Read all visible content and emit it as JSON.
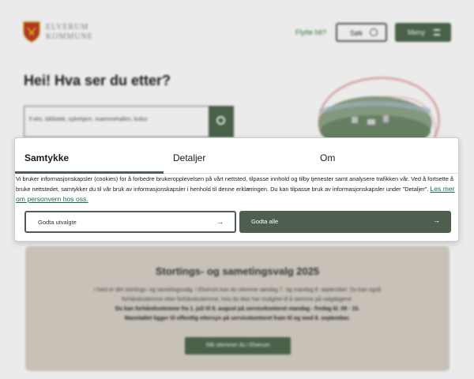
{
  "header": {
    "logo_text_line1": "ELVERUM",
    "logo_text_line2": "KOMMUNE",
    "nav_link_label": "Flytte hit?",
    "search_button_label": "Søk",
    "menu_button_label": "Meny",
    "icons": {
      "crest": "crest-icon",
      "search": "search-icon",
      "menu": "menu-icon"
    }
  },
  "hero": {
    "title": "Hei! Hva ser du etter?",
    "search_placeholder": "F.eks. bibliotek, sykehjem, svømmehallen, kultur"
  },
  "election": {
    "title": "Stortings- og sametingsvalg 2025",
    "body_line1": "I høst er det stortings- og sametingsvalg. I Elverum kan du stemme søndag 7. og mandag 8. september. Du kan også",
    "body_line2": "forhåndsstemme etter forhåndsstemme, hvis du ikke har mulighet til å stemme på valgdagene.",
    "body_bold1": "Du kan forhåndsstemme fra 1. juli til 8. august på servicekontoret mandag - fredag kl. 09 - 15.",
    "body_bold2": "Manntallet ligger til offentlig ettersyn på servicekontoret fram til og med 8. september.",
    "button_label": "Slik stemmer du i Elverum"
  },
  "consent": {
    "tabs": [
      {
        "label": "Samtykke",
        "active": true
      },
      {
        "label": "Detaljer",
        "active": false
      },
      {
        "label": "Om",
        "active": false
      }
    ],
    "text": "Vi bruker informasjonskapsler (cookies) for å forbedre brukeropplevelsen på vårt nettsted, tilpasse innhold og tilby tjenester samt analysere trafikken vår. Ved å fortsette å bruke nettstedet, samtykker du til vår bruk av informasjonskapsler i henhold til denne erklæringen. Du kan tilpasse bruk av informasjonskapsler under \"Detaljer\".",
    "link_label": "Les mer om personvern hos oss.",
    "button_selected_label": "Godta utvalgte",
    "button_all_label": "Godta alle",
    "arrow_icon": "arrow-right-icon"
  },
  "colors": {
    "accent_green": "#4f5f4f",
    "link_green": "#1e6b4b",
    "brand_green": "#4f6a4f",
    "election_panel": "#d8d2c8"
  }
}
